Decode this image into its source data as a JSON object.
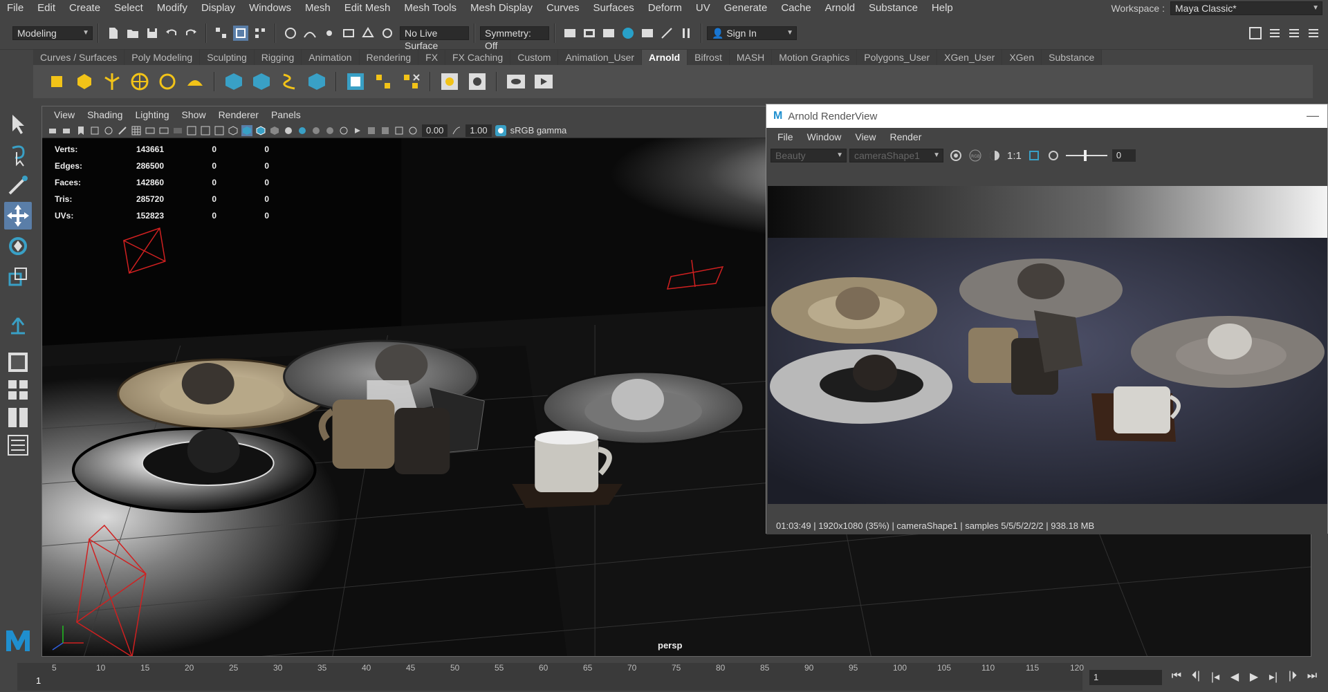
{
  "menubar": {
    "items": [
      "File",
      "Edit",
      "Create",
      "Select",
      "Modify",
      "Display",
      "Windows",
      "Mesh",
      "Edit Mesh",
      "Mesh Tools",
      "Mesh Display",
      "Curves",
      "Surfaces",
      "Deform",
      "UV",
      "Generate",
      "Cache",
      "Arnold",
      "Substance",
      "Help"
    ],
    "workspace_label": "Workspace :",
    "workspace_value": "Maya Classic*"
  },
  "statusline": {
    "mode": "Modeling",
    "live_surface": "No Live Surface",
    "symmetry": "Symmetry: Off",
    "sign_in": "Sign In"
  },
  "shelf": {
    "tabs": [
      "Curves / Surfaces",
      "Poly Modeling",
      "Sculpting",
      "Rigging",
      "Animation",
      "Rendering",
      "FX",
      "FX Caching",
      "Custom",
      "Animation_User",
      "Arnold",
      "Bifrost",
      "MASH",
      "Motion Graphics",
      "Polygons_User",
      "XGen_User",
      "XGen",
      "Substance"
    ],
    "active_tab": "Arnold"
  },
  "viewport": {
    "menu": [
      "View",
      "Shading",
      "Lighting",
      "Show",
      "Renderer",
      "Panels"
    ],
    "exposure": "0.00",
    "gamma": "1.00",
    "color_space": "sRGB gamma",
    "camera_label": "persp",
    "hud": [
      {
        "label": "Verts:",
        "total": "143661",
        "sel1": "0",
        "sel2": "0"
      },
      {
        "label": "Edges:",
        "total": "286500",
        "sel1": "0",
        "sel2": "0"
      },
      {
        "label": "Faces:",
        "total": "142860",
        "sel1": "0",
        "sel2": "0"
      },
      {
        "label": "Tris:",
        "total": "285720",
        "sel1": "0",
        "sel2": "0"
      },
      {
        "label": "UVs:",
        "total": "152823",
        "sel1": "0",
        "sel2": "0"
      }
    ]
  },
  "renderview": {
    "title": "Arnold RenderView",
    "menu": [
      "File",
      "Window",
      "View",
      "Render"
    ],
    "aov": "Beauty",
    "camera": "cameraShape1",
    "ratio": "1:1",
    "exposure": "0",
    "status": "01:03:49 | 1920x1080 (35%) | cameraShape1 | samples 5/5/5/2/2/2 | 938.18 MB"
  },
  "timeline": {
    "current_frame_label": "1",
    "frame_input": "1",
    "ticks": [
      "5",
      "10",
      "15",
      "20",
      "25",
      "30",
      "35",
      "40",
      "45",
      "50",
      "55",
      "60",
      "65",
      "70",
      "75",
      "80",
      "85",
      "90",
      "95",
      "100",
      "105",
      "110",
      "115",
      "120"
    ]
  },
  "colors": {
    "bg": "#444444",
    "active_tool": "#5a7ea8",
    "maya_blue": "#1f8fcf",
    "light_red": "#d02020"
  }
}
